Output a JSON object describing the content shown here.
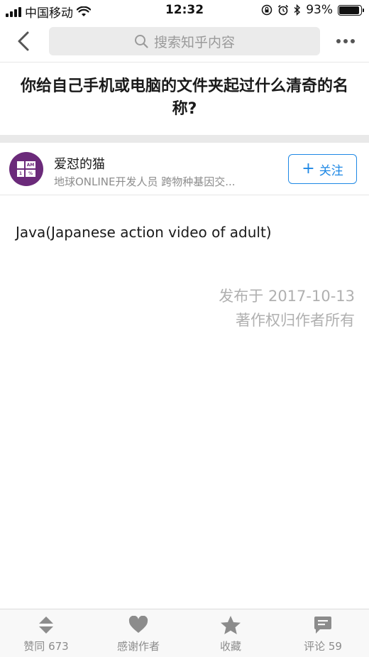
{
  "status_bar": {
    "carrier": "中国移动",
    "time": "12:32",
    "battery_percent": "93%",
    "battery_level": 0.93
  },
  "nav": {
    "search_placeholder": "搜索知乎内容"
  },
  "question": {
    "title": "你给自己手机或电脑的文件夹起过什么清奇的名称?"
  },
  "author": {
    "name": "爱怼的猫",
    "bio": "地球ONLINE开发人员 跨物种基因交...",
    "avatar_tiles": [
      "",
      "AM",
      "1",
      "%"
    ],
    "follow_label": "关注"
  },
  "answer": {
    "content": "Java(Japanese action video of adult)",
    "published": "发布于 2017-10-13",
    "copyright": "著作权归作者所有"
  },
  "bottom_bar": {
    "upvote_label": "赞同 673",
    "thanks_label": "感谢作者",
    "collect_label": "收藏",
    "comment_label": "评论 59"
  },
  "colors": {
    "accent": "#1e88e5",
    "avatar_bg": "#6b2a7a",
    "icon_gray": "#8c8c8c"
  },
  "icons": [
    "signal-icon",
    "wifi-icon",
    "screen-lock-icon",
    "alarm-icon",
    "bluetooth-icon",
    "battery-icon",
    "back-arrow-icon",
    "search-icon",
    "more-icon",
    "plus-icon",
    "upvote-icon",
    "heart-icon",
    "star-icon",
    "comment-icon"
  ]
}
